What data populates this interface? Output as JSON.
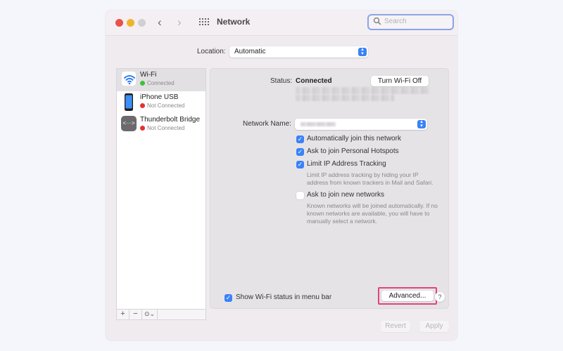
{
  "window": {
    "title": "Network",
    "search_placeholder": "Search"
  },
  "location": {
    "label": "Location:",
    "value": "Automatic"
  },
  "sidebar": {
    "items": [
      {
        "name": "Wi-Fi",
        "status": "Connected",
        "status_color": "#3ec13e",
        "selected": true,
        "icon": "wifi-icon"
      },
      {
        "name": "iPhone USB",
        "status": "Not Connected",
        "status_color": "#e3322f",
        "selected": false,
        "icon": "iphone-icon"
      },
      {
        "name": "Thunderbolt Bridge",
        "status": "Not Connected",
        "status_color": "#e3322f",
        "selected": false,
        "icon": "thunderbolt-bridge-icon"
      }
    ],
    "add_label": "+",
    "remove_label": "−",
    "actions_label": "⊙⌄"
  },
  "detail": {
    "status_label": "Status:",
    "status_value": "Connected",
    "turn_off_label": "Turn Wi-Fi Off",
    "network_name_label": "Network Name:",
    "options": [
      {
        "label": "Automatically join this network",
        "checked": true
      },
      {
        "label": "Ask to join Personal Hotspots",
        "checked": true
      },
      {
        "label": "Limit IP Address Tracking",
        "checked": true
      },
      {
        "label": "Ask to join new networks",
        "checked": false
      }
    ],
    "limit_ip_help": [
      "Limit IP address tracking by hiding your IP",
      "address from known trackers in Mail and Safari."
    ],
    "new_networks_help": [
      "Known networks will be joined automatically. If no",
      "known networks are available, you will have to",
      "manually select a network."
    ],
    "show_status_label": "Show Wi-Fi status in menu bar",
    "show_status_checked": true,
    "advanced_label": "Advanced...",
    "help_label": "?"
  },
  "footer": {
    "revert_label": "Revert",
    "apply_label": "Apply"
  },
  "colors": {
    "accent": "#3a82f7",
    "highlight": "#e0457a"
  }
}
